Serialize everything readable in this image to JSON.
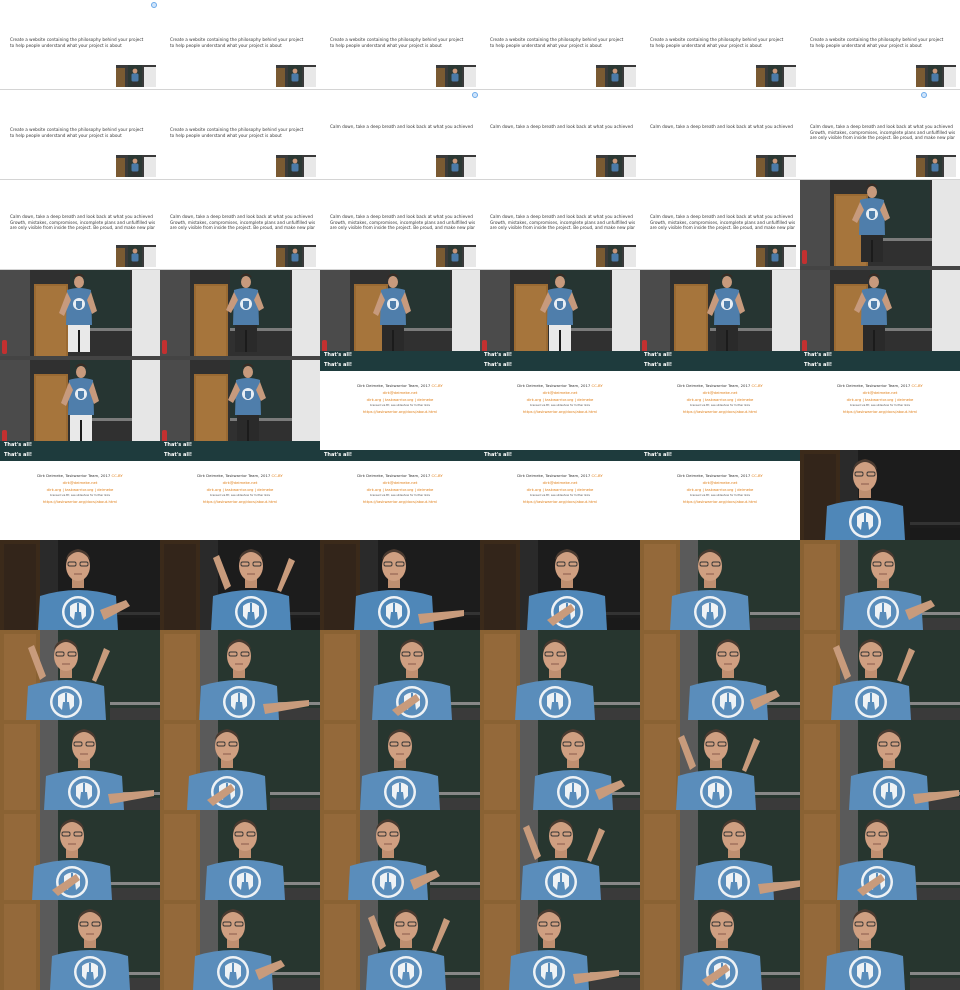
{
  "slide_text": {
    "create_line_1": "Create a website containing the philosophy behind your project",
    "create_line_2": "to help people understand what your project is about",
    "calm_line_1": "Calm down, take a deep breath and look back at what you achieved",
    "calm_line_2": "Growth, mistakes, compromises, incomplete plans and unfulfilled wishes",
    "calm_line_3": "are only visible from inside the project. Be proud, and make new plans"
  },
  "end_slide": {
    "title": "That's all!",
    "author": "Dirk Deimeke, Taskwarrior Team, 2017",
    "license": "CC-BY",
    "email": "dirk@deimeke.net",
    "links": "dirk.org  |  taskwarrior.org  |  deimeke",
    "note": "licensed via BY, see slideshow for further links",
    "url": "https://taskwarrior.org/docs/about.html"
  }
}
